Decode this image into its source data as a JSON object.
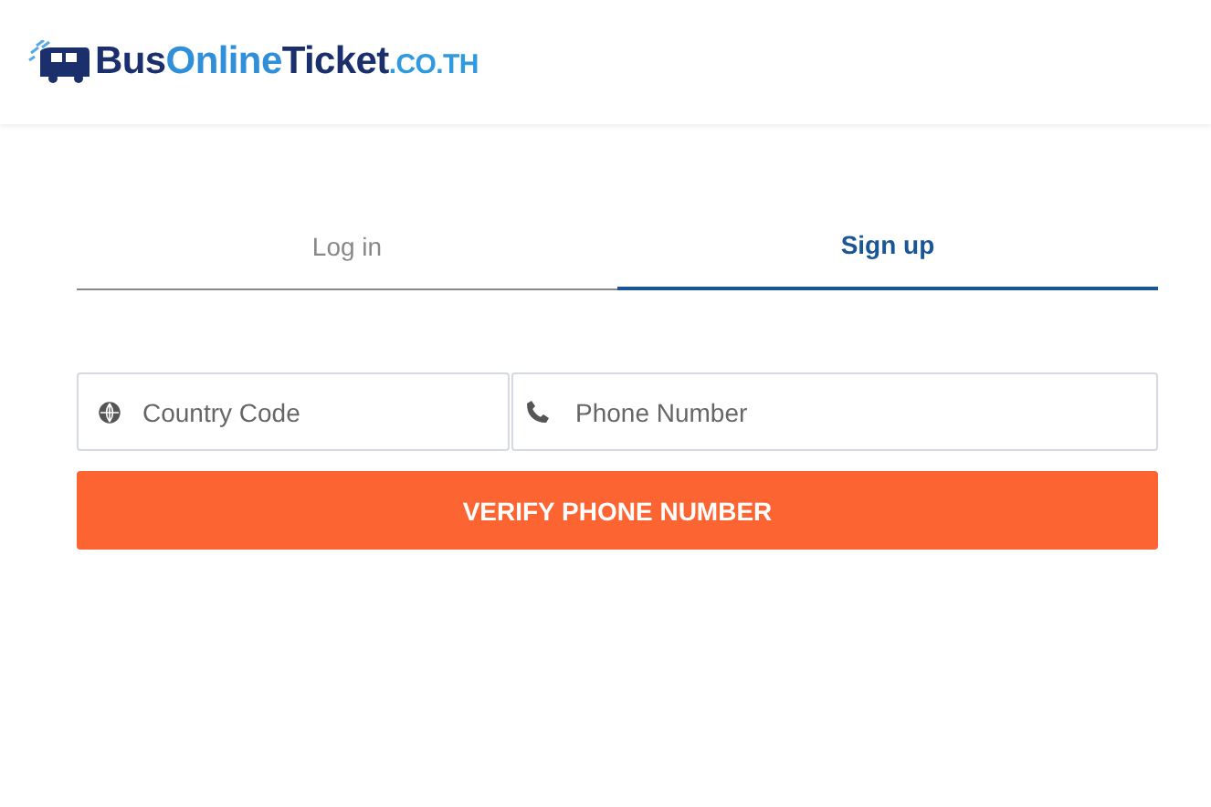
{
  "logo": {
    "parts": [
      {
        "text": "Bus",
        "kind": "dark"
      },
      {
        "text": "Online",
        "kind": "light"
      },
      {
        "text": "Ticket",
        "kind": "dark"
      },
      {
        "text": ".CO.TH",
        "kind": "suffix"
      }
    ]
  },
  "tabs": [
    {
      "label": "Log in",
      "selected": false
    },
    {
      "label": "Sign up",
      "selected": true
    }
  ],
  "fields": [
    {
      "kind": "globe",
      "placeholder": "Country Code"
    },
    {
      "kind": "phone",
      "placeholder": "Phone Number"
    }
  ],
  "button": {
    "label": "VERIFY PHONE NUMBER"
  }
}
